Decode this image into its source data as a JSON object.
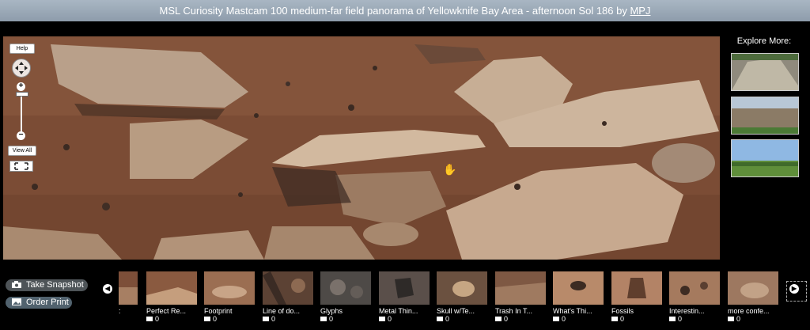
{
  "title": {
    "text": "MSL Curiosity Mastcam 100 medium-far field panorama of Yellowknife Bay Area - afternoon Sol 186 by ",
    "author_link": "MPJ"
  },
  "viewer": {
    "help_label": "Help",
    "view_all_label": "View All"
  },
  "explore": {
    "heading": "Explore More:"
  },
  "actions": {
    "snapshot_label": "Take Snapshot",
    "print_label": "Order Print"
  },
  "strip": {
    "partial_label": ":",
    "items": [
      {
        "label": "Perfect Re...",
        "count": "0"
      },
      {
        "label": "Footprint",
        "count": "0"
      },
      {
        "label": "Line of do...",
        "count": "0"
      },
      {
        "label": "Glyphs",
        "count": "0"
      },
      {
        "label": "Metal Thin...",
        "count": "0"
      },
      {
        "label": "Skull w/Te...",
        "count": "0"
      },
      {
        "label": "Trash In T...",
        "count": "0"
      },
      {
        "label": "What's Thi...",
        "count": "0"
      },
      {
        "label": "Fossils",
        "count": "0"
      },
      {
        "label": "Interestin...",
        "count": "0"
      },
      {
        "label": "more confe...",
        "count": "0"
      }
    ]
  },
  "icons": {
    "pan": "pan-control-icon",
    "zoom_in": "zoom-in-icon",
    "zoom_out": "zoom-out-icon",
    "fullscreen": "fullscreen-icon",
    "camera": "camera-icon",
    "picture": "picture-icon",
    "comment": "comment-icon",
    "hand": "hand-cursor-icon"
  }
}
